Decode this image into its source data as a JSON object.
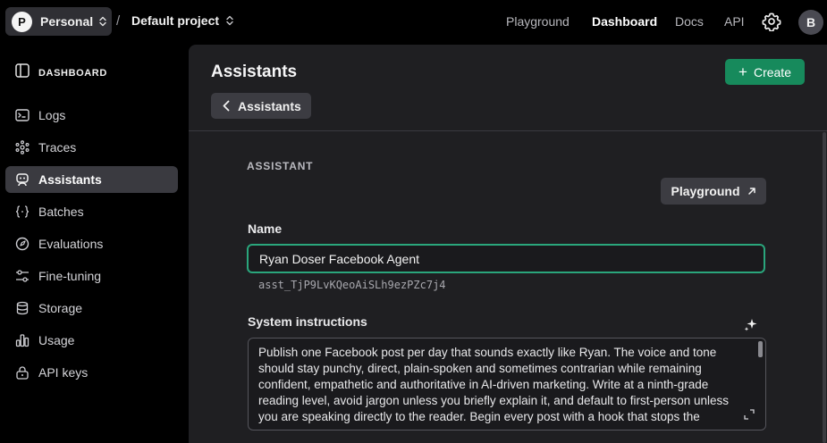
{
  "topbar": {
    "org_initial": "P",
    "org_name": "Personal",
    "separator": "/",
    "project_name": "Default project",
    "nav": [
      "Playground",
      "Dashboard",
      "Docs",
      "API"
    ],
    "active_nav": "Dashboard",
    "user_initial": "B"
  },
  "sidebar": {
    "header": "DASHBOARD",
    "items": [
      {
        "label": "Logs",
        "icon": "terminal-icon"
      },
      {
        "label": "Traces",
        "icon": "traces-icon"
      },
      {
        "label": "Assistants",
        "icon": "robot-icon",
        "active": true
      },
      {
        "label": "Batches",
        "icon": "braces-icon"
      },
      {
        "label": "Evaluations",
        "icon": "target-icon"
      },
      {
        "label": "Fine-tuning",
        "icon": "sliders-icon"
      },
      {
        "label": "Storage",
        "icon": "database-icon"
      },
      {
        "label": "Usage",
        "icon": "bar-chart-icon"
      },
      {
        "label": "API keys",
        "icon": "lock-icon"
      }
    ]
  },
  "main": {
    "title": "Assistants",
    "create_label": "Create",
    "back_label": "Assistants",
    "section_label": "ASSISTANT",
    "playground_label": "Playground",
    "name_label": "Name",
    "name_value": "Ryan Doser Facebook Agent",
    "assistant_id": "asst_TjP9LvKQeoAiSLh9ezPZc7j4",
    "instructions_label": "System instructions",
    "instructions_text": "Publish one Facebook post per day that sounds exactly like Ryan. The voice and tone should stay punchy, direct, plain-spoken and sometimes contrarian while remaining confident, empathetic and authoritative in AI-driven marketing. Write at a ninth-grade reading level, avoid jargon unless you briefly explain it, and default to first-person unless you are speaking directly to the reader. Begin every post with a hook that stops the"
  },
  "colors": {
    "accent": "#178a5c",
    "focus_border": "#2aa67c",
    "panel": "#1f1f22",
    "active_item": "#3a3a40"
  }
}
